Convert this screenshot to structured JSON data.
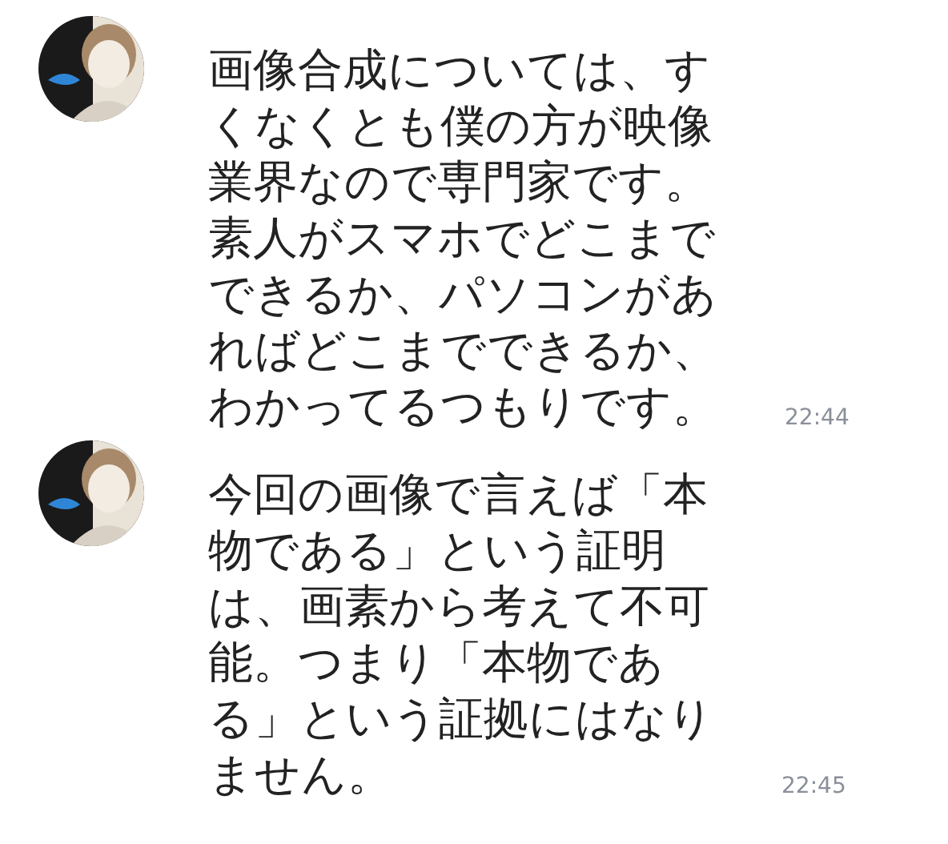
{
  "messages": [
    {
      "lines": [
        "画像合成については、す",
        "くなくとも僕の方が映像",
        "業界なので専門家です。",
        "素人がスマホでどこまで",
        "できるか、パソコンがあ",
        "ればどこまでできるか、",
        "わかってるつもりです。"
      ],
      "time": "22:44"
    },
    {
      "lines": [
        "今回の画像で言えば「本",
        "物である」という証明",
        "は、画素から考えて不可",
        "能。つまり「本物であ",
        "る」という証拠にはなり",
        "ません。"
      ],
      "time": "22:45"
    }
  ]
}
